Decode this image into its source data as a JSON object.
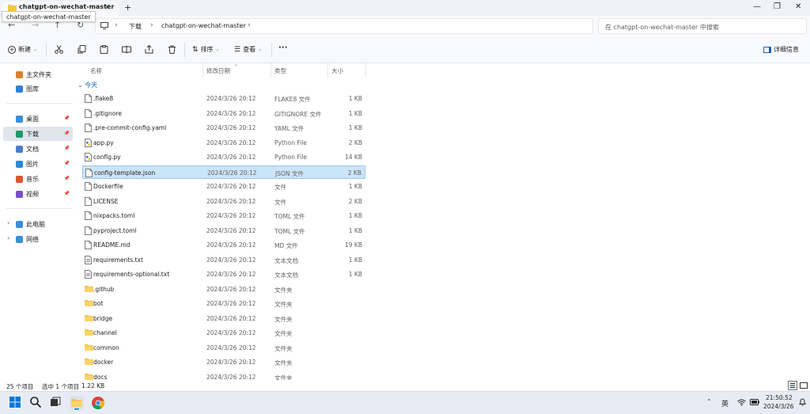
{
  "window": {
    "tab_title": "chatgpt-on-wechat-master",
    "tooltip": "chatgpt-on-wechat-master",
    "new_tab": "+",
    "tab_close": "×",
    "minimize": "—",
    "maximize": "❐",
    "close": "✕"
  },
  "address": {
    "crumbs": [
      "下载",
      "chatgpt-on-wechat-master"
    ],
    "search_placeholder": "在 chatgpt-on-wechat-master 中搜索"
  },
  "toolbar": {
    "new_label": "新建",
    "sort_label": "排序",
    "view_label": "查看",
    "more_label": "···",
    "details_label": "详细信息"
  },
  "sidebar": {
    "quick": [
      {
        "label": "主文件夹",
        "icon": "home-icon",
        "color": "#d9822b"
      },
      {
        "label": "图库",
        "icon": "gallery-icon",
        "color": "#2f7fd8"
      }
    ],
    "pinned": [
      {
        "label": "桌面",
        "icon": "desktop-icon",
        "color": "#3b8ed8"
      },
      {
        "label": "下载",
        "icon": "download-icon",
        "color": "#1f9a6a"
      },
      {
        "label": "文档",
        "icon": "documents-icon",
        "color": "#4a7ccf"
      },
      {
        "label": "图片",
        "icon": "pictures-icon",
        "color": "#2c8ad8"
      },
      {
        "label": "音乐",
        "icon": "music-icon",
        "color": "#e0552f"
      },
      {
        "label": "视频",
        "icon": "videos-icon",
        "color": "#7a4fc8"
      }
    ],
    "devices": [
      {
        "label": "此电脑",
        "icon": "computer-icon",
        "color": "#3b8ed8"
      },
      {
        "label": "网络",
        "icon": "network-icon",
        "color": "#3b8ed8"
      }
    ]
  },
  "columns": {
    "name": "名称",
    "modified": "修改日期",
    "type": "类型",
    "size": "大小"
  },
  "group_label": "今天",
  "files": [
    {
      "name": ".flake8",
      "date": "2024/3/26 20:12",
      "type": "FLAKE8 文件",
      "size": "1 KB",
      "kind": "file"
    },
    {
      "name": ".gitignore",
      "date": "2024/3/26 20:12",
      "type": "GITIGNORE 文件",
      "size": "1 KB",
      "kind": "file"
    },
    {
      "name": ".pre-commit-config.yaml",
      "date": "2024/3/26 20:12",
      "type": "YAML 文件",
      "size": "1 KB",
      "kind": "file"
    },
    {
      "name": "app.py",
      "date": "2024/3/26 20:12",
      "type": "Python File",
      "size": "2 KB",
      "kind": "python"
    },
    {
      "name": "config.py",
      "date": "2024/3/26 20:12",
      "type": "Python File",
      "size": "14 KB",
      "kind": "python"
    },
    {
      "name": "config-template.json",
      "date": "2024/3/26 20:12",
      "type": "JSON 文件",
      "size": "2 KB",
      "kind": "file"
    },
    {
      "name": "Dockerfile",
      "date": "2024/3/26 20:12",
      "type": "文件",
      "size": "1 KB",
      "kind": "file"
    },
    {
      "name": "LICENSE",
      "date": "2024/3/26 20:12",
      "type": "文件",
      "size": "2 KB",
      "kind": "file"
    },
    {
      "name": "nixpacks.toml",
      "date": "2024/3/26 20:12",
      "type": "TOML 文件",
      "size": "1 KB",
      "kind": "file"
    },
    {
      "name": "pyproject.toml",
      "date": "2024/3/26 20:12",
      "type": "TOML 文件",
      "size": "1 KB",
      "kind": "file"
    },
    {
      "name": "README.md",
      "date": "2024/3/26 20:12",
      "type": "MD 文件",
      "size": "19 KB",
      "kind": "file"
    },
    {
      "name": "requirements.txt",
      "date": "2024/3/26 20:12",
      "type": "文本文档",
      "size": "1 KB",
      "kind": "text"
    },
    {
      "name": "requirements-optional.txt",
      "date": "2024/3/26 20:12",
      "type": "文本文档",
      "size": "1 KB",
      "kind": "text"
    },
    {
      "name": ".github",
      "date": "2024/3/26 20:12",
      "type": "文件夹",
      "size": "",
      "kind": "folder"
    },
    {
      "name": "bot",
      "date": "2024/3/26 20:12",
      "type": "文件夹",
      "size": "",
      "kind": "folder"
    },
    {
      "name": "bridge",
      "date": "2024/3/26 20:12",
      "type": "文件夹",
      "size": "",
      "kind": "folder"
    },
    {
      "name": "channel",
      "date": "2024/3/26 20:12",
      "type": "文件夹",
      "size": "",
      "kind": "folder"
    },
    {
      "name": "common",
      "date": "2024/3/26 20:12",
      "type": "文件夹",
      "size": "",
      "kind": "folder"
    },
    {
      "name": "docker",
      "date": "2024/3/26 20:12",
      "type": "文件夹",
      "size": "",
      "kind": "folder"
    },
    {
      "name": "docs",
      "date": "2024/3/26 20:12",
      "type": "文件夹",
      "size": "",
      "kind": "folder"
    }
  ],
  "selected_file": "config-template.json",
  "status": {
    "count": "25 个项目",
    "selection": "选中 1 个项目",
    "size": "1.22 KB"
  },
  "taskbar": {
    "ime": "英",
    "time": "21:50:52",
    "date": "2024/3/26"
  },
  "colors": {
    "accent": "#1a5fb4",
    "selection": "#cce4f7",
    "folder": "#f4c34a"
  }
}
